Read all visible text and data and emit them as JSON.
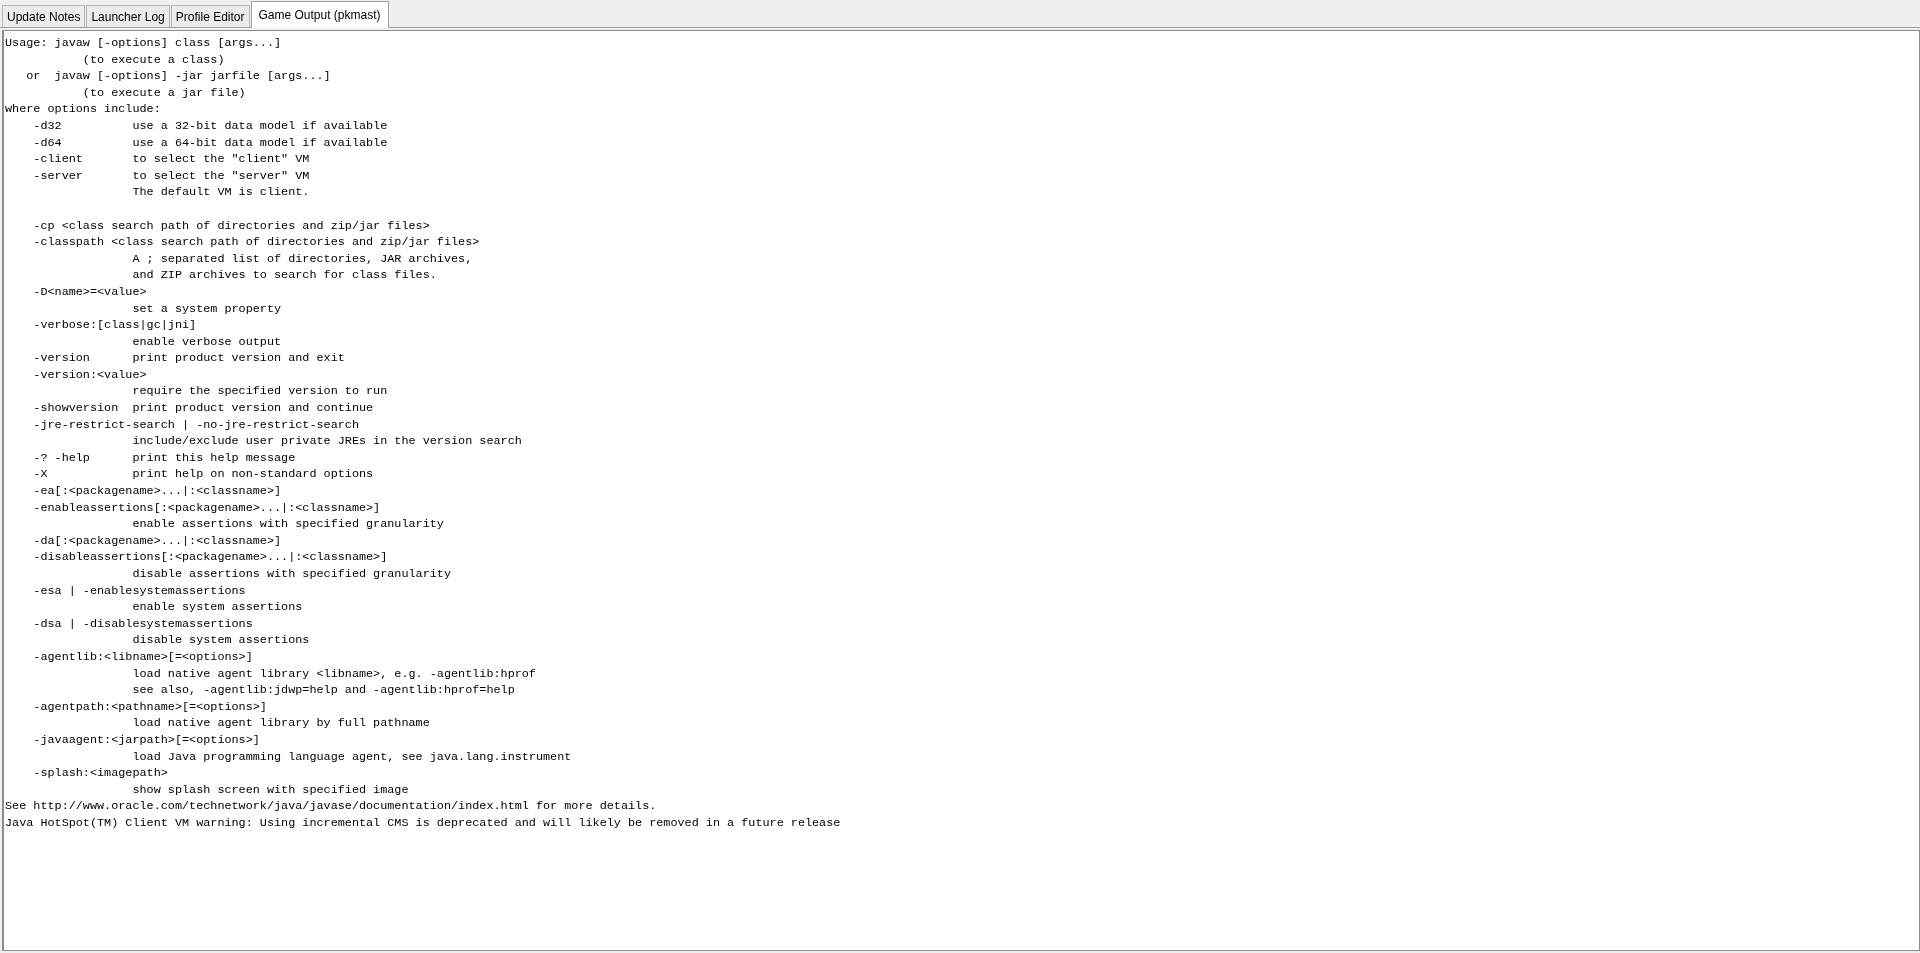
{
  "tabs": [
    {
      "label": "Update Notes",
      "selected": false
    },
    {
      "label": "Launcher Log",
      "selected": false
    },
    {
      "label": "Profile Editor",
      "selected": false
    },
    {
      "label": "Game Output (pkmast)",
      "selected": true
    }
  ],
  "console_output": "Usage: javaw [-options] class [args...]\n           (to execute a class)\n   or  javaw [-options] -jar jarfile [args...]\n           (to execute a jar file)\nwhere options include:\n    -d32          use a 32-bit data model if available\n    -d64          use a 64-bit data model if available\n    -client       to select the \"client\" VM\n    -server       to select the \"server\" VM\n                  The default VM is client.\n\n    -cp <class search path of directories and zip/jar files>\n    -classpath <class search path of directories and zip/jar files>\n                  A ; separated list of directories, JAR archives,\n                  and ZIP archives to search for class files.\n    -D<name>=<value>\n                  set a system property\n    -verbose:[class|gc|jni]\n                  enable verbose output\n    -version      print product version and exit\n    -version:<value>\n                  require the specified version to run\n    -showversion  print product version and continue\n    -jre-restrict-search | -no-jre-restrict-search\n                  include/exclude user private JREs in the version search\n    -? -help      print this help message\n    -X            print help on non-standard options\n    -ea[:<packagename>...|:<classname>]\n    -enableassertions[:<packagename>...|:<classname>]\n                  enable assertions with specified granularity\n    -da[:<packagename>...|:<classname>]\n    -disableassertions[:<packagename>...|:<classname>]\n                  disable assertions with specified granularity\n    -esa | -enablesystemassertions\n                  enable system assertions\n    -dsa | -disablesystemassertions\n                  disable system assertions\n    -agentlib:<libname>[=<options>]\n                  load native agent library <libname>, e.g. -agentlib:hprof\n                  see also, -agentlib:jdwp=help and -agentlib:hprof=help\n    -agentpath:<pathname>[=<options>]\n                  load native agent library by full pathname\n    -javaagent:<jarpath>[=<options>]\n                  load Java programming language agent, see java.lang.instrument\n    -splash:<imagepath>\n                  show splash screen with specified image\nSee http://www.oracle.com/technetwork/java/javase/documentation/index.html for more details.\nJava HotSpot(TM) Client VM warning: Using incremental CMS is deprecated and will likely be removed in a future release"
}
